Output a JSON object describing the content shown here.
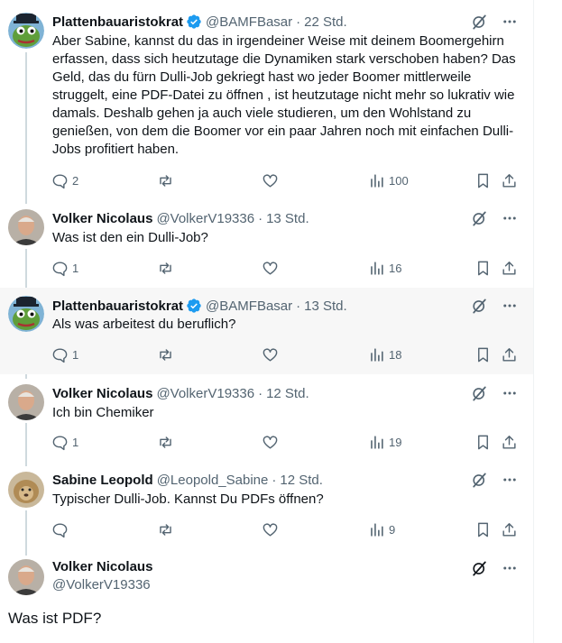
{
  "tweets": [
    {
      "name": "Plattenbauaristokrat",
      "verified": true,
      "handle": "@BAMFBasar",
      "time": "22 Std.",
      "text": "Aber Sabine, kannst du das in irgendeiner Weise mit deinem Boomergehirn erfassen, dass sich heutzutage die Dynamiken stark verschoben haben? Das Geld, das du fürn Dulli-Job gekriegt hast wo jeder Boomer mittlerweile struggelt, eine PDF-Datei zu öffnen , ist heutzutage nicht mehr so lukrativ wie damals. Deshalb gehen ja auch viele studieren, um den Wohlstand zu genießen, von dem die Boomer vor ein paar Jahren noch mit einfachen Dulli-Jobs profitiert haben.",
      "replies": "2",
      "views": "100",
      "avatar": "pepe"
    },
    {
      "name": "Volker Nicolaus",
      "verified": false,
      "handle": "@VolkerV19336",
      "time": "13 Std.",
      "text": "Was ist den ein Dulli-Job?",
      "replies": "1",
      "views": "16",
      "avatar": "man"
    },
    {
      "name": "Plattenbauaristokrat",
      "verified": true,
      "handle": "@BAMFBasar",
      "time": "13 Std.",
      "text": "Als was arbeitest du beruflich?",
      "replies": "1",
      "views": "18",
      "avatar": "pepe"
    },
    {
      "name": "Volker Nicolaus",
      "verified": false,
      "handle": "@VolkerV19336",
      "time": "12 Std.",
      "text": "Ich bin Chemiker",
      "replies": "1",
      "views": "19",
      "avatar": "man"
    },
    {
      "name": "Sabine Leopold",
      "verified": false,
      "handle": "@Leopold_Sabine",
      "time": "12 Std.",
      "text": "Typischer Dulli-Job. Kannst Du PDFs öffnen?",
      "replies": "",
      "views": "9",
      "avatar": "lion"
    }
  ],
  "focus": {
    "name": "Volker Nicolaus",
    "handle": "@VolkerV19336",
    "text": "Was ist PDF?",
    "avatar": "man"
  },
  "dot": "·",
  "colors": {
    "accent": "#1d9bf0",
    "secondary_text": "#536471",
    "thread_line": "#cfd9de"
  }
}
